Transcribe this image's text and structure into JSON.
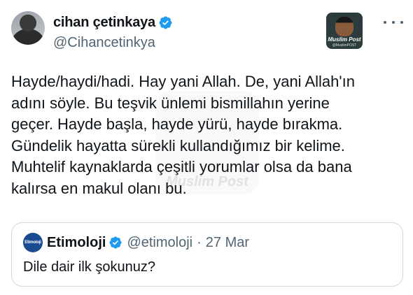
{
  "author": {
    "display_name": "cihan çetinkaya",
    "handle": "@Cihancetinkya",
    "verified_icon": "verified-badge-icon"
  },
  "source_badge": {
    "title": "Muslim Post",
    "subtitle": "@MuslimPOST"
  },
  "tweet": {
    "text": "Hayde/haydi/hadi. Hay yani Allah. De, yani Allah'ın\nadını söyle. Bu teşvik ünlemi bismillahın yerine\ngeçer. Hayde başla, hayde yürü, hayde bırakma.\nGündelik hayatta sürekli kullandığımız bir kelime.\nMuhtelif kaynaklarda çeşitli yorumlar olsa da bana\nkalırsa en makul olanı bu."
  },
  "watermark": {
    "text": "Muslim Post"
  },
  "quoted_tweet": {
    "avatar_text": "Etimoloji",
    "display_name": "Etimoloji",
    "handle": "@etimoloji",
    "separator": "·",
    "date": "27 Mar",
    "text": "Dile dair ilk şokunuz?"
  },
  "colors": {
    "verified_blue": "#1d9bf0",
    "secondary_text": "#536471",
    "border": "#cfd9de"
  }
}
